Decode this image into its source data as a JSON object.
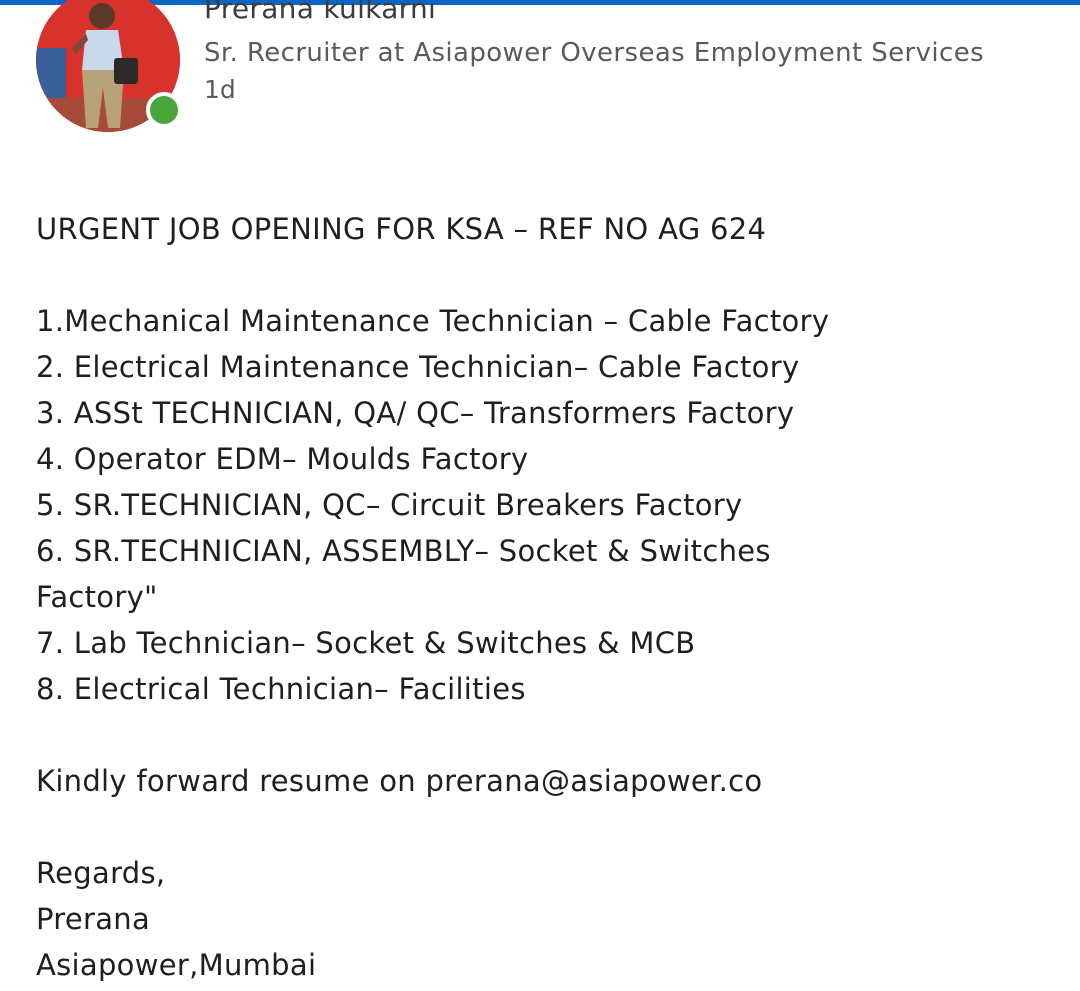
{
  "post": {
    "author": {
      "name": "Prerana kulkarni",
      "headline": "Sr. Recruiter at Asiapower Overseas Employment Services",
      "time": "1d",
      "online": true
    },
    "title": "URGENT JOB OPENING FOR  KSA – REF NO AG 624",
    "jobs": [
      "1.Mechanical Maintenance Technician – Cable Factory",
      "2. Electrical Maintenance Technician– Cable Factory",
      "3. ASSt TECHNICIAN, QA/ QC– Transformers Factory",
      "4. Operator EDM–  Moulds Factory",
      "5. SR.TECHNICIAN, QC– Circuit Breakers Factory",
      "6. SR.TECHNICIAN, ASSEMBLY– Socket & Switches",
      "Factory\"",
      "7. Lab Technician– Socket & Switches & MCB",
      "8. Electrical Technician– Facilities"
    ],
    "cta": "Kindly forward resume on prerana@asiapower.co",
    "signoff": [
      "Regards,",
      "Prerana",
      "Asiapower,Mumbai"
    ]
  },
  "colors": {
    "accent": "#0a66c2",
    "online": "#4aa53a",
    "avatar_bg": "#d8322c"
  }
}
